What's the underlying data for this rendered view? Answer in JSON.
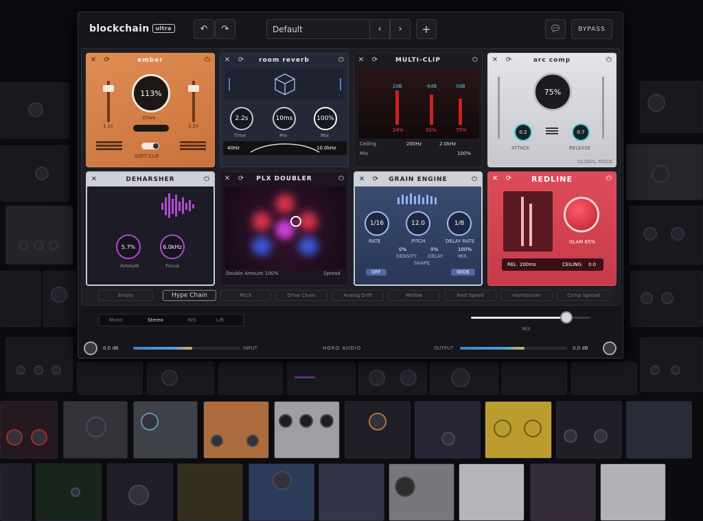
{
  "app": {
    "name": "blockchain",
    "badge": "ultra",
    "vendor": "HORO AUDIO"
  },
  "toolbar": {
    "undo_icon": "undo-icon",
    "redo_icon": "redo-icon",
    "preset_name": "Default",
    "prev_icon": "chevron-left-icon",
    "next_icon": "chevron-right-icon",
    "add_icon": "plus-icon",
    "chat_icon": "chat-icon",
    "bypass_label": "BYPASS"
  },
  "plugins": [
    {
      "id": "ember",
      "title": "ember",
      "color": "#d6814a",
      "main_value": "113%",
      "sub_label": "Drive",
      "left_value": "1.1s",
      "right_value": "1.2s",
      "toggle_label": "SOFT CLIP"
    },
    {
      "id": "room-reverb",
      "title": "room reverb",
      "color": "#2a2d3a",
      "knobs": [
        "2.2s",
        "10ms",
        "100%"
      ],
      "knob_labels": [
        "Time",
        "Pre",
        "Mix"
      ],
      "freq_low": "40Hz",
      "freq_high": "10.0kHz"
    },
    {
      "id": "multi-clip",
      "title": "MULTI-CLIP",
      "color": "#1b1b22",
      "band_values": [
        "2dB",
        "-6dB",
        "0dB"
      ],
      "band_pcts": [
        "24%",
        "50%",
        "75%"
      ],
      "ceiling_label": "Ceiling",
      "ceiling_value": "200Hz",
      "crossover": "2.0kHz",
      "mix_label": "Mix",
      "mix_value": "100%"
    },
    {
      "id": "silver-comp",
      "title": "arc comp",
      "color": "#d5d6da",
      "main_value": "75%",
      "small_knobs": [
        "0.2",
        "0.7"
      ],
      "small_labels": [
        "ATTACK",
        "RELEASE"
      ],
      "footer_label": "GLOBAL MODE"
    },
    {
      "id": "deharsher",
      "title": "DEHARSHER",
      "color": "#1c1c25",
      "knobs": [
        "5.7%",
        "6.0kHz"
      ],
      "knob_labels": [
        "Amount",
        "Focus"
      ]
    },
    {
      "id": "plx-doubler",
      "title": "PLX DOUBLER",
      "color": "#2a1722",
      "footer": "Double Amount 100%",
      "footer_right": "Spread"
    },
    {
      "id": "grain-engine",
      "title": "GRAIN ENGINE",
      "color": "#3a4a68",
      "knobs": [
        "1/16",
        "12.0",
        "1/8"
      ],
      "knob_labels": [
        "RATE",
        "PITCH",
        "DELAY RATE"
      ],
      "row_values": [
        "0%",
        "0%",
        "100%"
      ],
      "row_labels": [
        "DENSITY",
        "DELAY",
        "MIX"
      ],
      "sub_label": "SHAPE",
      "chip_left": "OFF",
      "chip_right": "WIDE"
    },
    {
      "id": "redline",
      "title": "REDLINE",
      "color": "#d54453",
      "knob_label": "GLAM 65%",
      "rel_label": "REL",
      "rel_value": "200ms",
      "ceiling_label": "CEILING",
      "ceiling_value": "0.0"
    }
  ],
  "slot_tabs": [
    "Empty",
    "Hype Chain",
    "Pitch",
    "Drive Chain",
    "Analog Drift",
    "Mellow",
    "Reel Speed",
    "Harmonizer",
    "Comp Spread"
  ],
  "footer": {
    "mode_tabs": [
      "Mono",
      "Stereo",
      "M/S",
      "L/R"
    ],
    "mix_label": "MIX",
    "input_label": "INPUT",
    "input_value": "0.0 dB",
    "output_label": "OUTPUT",
    "output_value": "0.0 dB",
    "input_level": 0.55,
    "output_level": 0.6,
    "mix_level": 0.8
  },
  "colors": {
    "accent_blue": "#4ea2dc",
    "accent_orange": "#e3b34a",
    "accent_red": "#e03a4a",
    "accent_purple": "#b04bd6"
  }
}
